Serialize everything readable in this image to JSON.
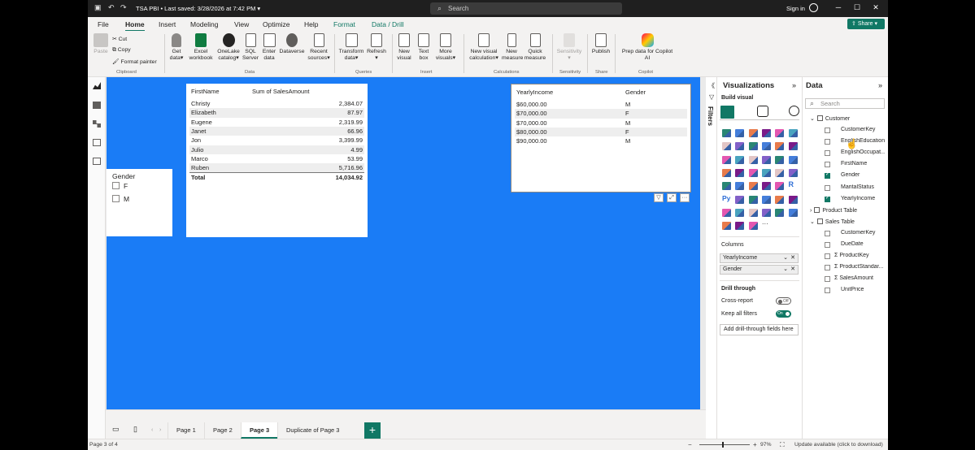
{
  "titlebar": {
    "file_name": "TSA PBI",
    "saved": "Last saved: 3/28/2026 at 7:42 PM",
    "search_placeholder": "Search",
    "signin": "Sign in"
  },
  "tabs": [
    "File",
    "Home",
    "Insert",
    "Modeling",
    "View",
    "Optimize",
    "Help",
    "Format",
    "Data / Drill"
  ],
  "share_label": "Share",
  "ribbon": {
    "paste": "Paste",
    "cut": "Cut",
    "copy": "Copy",
    "format_painter": "Format painter",
    "clipboard": "Clipboard",
    "get_data": [
      "Get",
      "data"
    ],
    "excel": [
      "Excel",
      "workbook"
    ],
    "onelake": [
      "OneLake",
      "catalog"
    ],
    "sql": [
      "SQL",
      "Server"
    ],
    "enter": [
      "Enter",
      "data"
    ],
    "dataverse": [
      "Dataverse",
      ""
    ],
    "recent": [
      "Recent",
      "sources"
    ],
    "data_group": "Data",
    "transform": [
      "Transform",
      "data"
    ],
    "refresh": [
      "Refresh",
      ""
    ],
    "queries_group": "Queries",
    "new_visual": [
      "New",
      "visual"
    ],
    "text_box": [
      "Text",
      "box"
    ],
    "more_visuals": [
      "More",
      "visuals"
    ],
    "insert_group": "Insert",
    "new_visual_calc": [
      "New visual",
      "calculation"
    ],
    "new_measure": [
      "New",
      "measure"
    ],
    "quick_measure": [
      "Quick",
      "measure"
    ],
    "calc_group": "Calculations",
    "sensitivity": [
      "Sensitivity",
      ""
    ],
    "sens_group": "Sensitivity",
    "publish": [
      "Publish",
      ""
    ],
    "share_group": "Share",
    "prep": [
      "Prep data for Copilot",
      "AI"
    ],
    "copilot_group": "Copilot"
  },
  "slicer": {
    "header": "Gender",
    "options": [
      "F",
      "M"
    ]
  },
  "sales_table": {
    "headers": [
      "FirstName",
      "Sum of SalesAmount"
    ],
    "rows": [
      [
        "Christy",
        "2,384.07"
      ],
      [
        "Elizabeth",
        "87.97"
      ],
      [
        "Eugene",
        "2,319.99"
      ],
      [
        "Janet",
        "66.96"
      ],
      [
        "Jon",
        "3,399.99"
      ],
      [
        "Julio",
        "4.99"
      ],
      [
        "Marco",
        "53.99"
      ],
      [
        "Ruben",
        "5,716.96"
      ]
    ],
    "total": [
      "Total",
      "14,034.92"
    ]
  },
  "income_table": {
    "headers": [
      "YearlyIncome",
      "Gender"
    ],
    "rows": [
      [
        "$60,000.00",
        "M"
      ],
      [
        "$70,000.00",
        "F"
      ],
      [
        "$70,000.00",
        "M"
      ],
      [
        "$80,000.00",
        "F"
      ],
      [
        "$90,000.00",
        "M"
      ]
    ]
  },
  "pages": [
    "Page 1",
    "Page 2",
    "Page 3",
    "Duplicate of Page 3"
  ],
  "add_page": "+",
  "status": {
    "page": "Page 3 of 4",
    "zoom": "97%",
    "update": "Update available (click to download)"
  },
  "filters_label": "Filters",
  "visualizations": {
    "title": "Visualizations",
    "build": "Build visual",
    "columns": "Columns",
    "wells": [
      "YearlyIncome",
      "Gender"
    ],
    "drill": "Drill through",
    "cross_report": "Cross-report",
    "cross_state": "Off",
    "keep_filters": "Keep all filters",
    "keep_state": "On",
    "add_drill": "Add drill-through fields here",
    "r_label": "R",
    "py_label": "Py",
    "more_label": "···"
  },
  "data_pane": {
    "title": "Data",
    "search": "Search",
    "tables": [
      {
        "name": "Customer",
        "fields": [
          {
            "name": "CustomerKey",
            "checked": false,
            "sigma": false
          },
          {
            "name": "EnglishEducation",
            "checked": false,
            "sigma": false
          },
          {
            "name": "EnglishOccupat...",
            "checked": false,
            "sigma": false
          },
          {
            "name": "FirstName",
            "checked": false,
            "sigma": false
          },
          {
            "name": "Gender",
            "checked": true,
            "sigma": false
          },
          {
            "name": "MaritalStatus",
            "checked": false,
            "sigma": false
          },
          {
            "name": "YearlyIncome",
            "checked": true,
            "sigma": false
          }
        ]
      },
      {
        "name": "Product Table",
        "fields": []
      },
      {
        "name": "Sales Table",
        "fields": [
          {
            "name": "CustomerKey",
            "checked": false,
            "sigma": false
          },
          {
            "name": "DueDate",
            "checked": false,
            "sigma": false
          },
          {
            "name": "ProductKey",
            "checked": false,
            "sigma": true
          },
          {
            "name": "ProductStandar...",
            "checked": false,
            "sigma": true
          },
          {
            "name": "SalesAmount",
            "checked": false,
            "sigma": true
          },
          {
            "name": "UnitPrice",
            "checked": false,
            "sigma": false
          }
        ]
      }
    ]
  },
  "colors": {
    "accent": "#117865",
    "canvas": "#1a7cf6"
  }
}
